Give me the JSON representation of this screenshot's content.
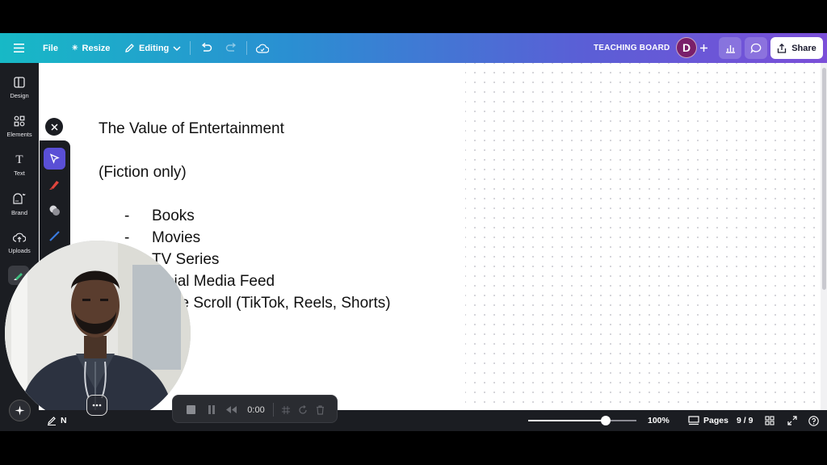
{
  "topbar": {
    "file_label": "File",
    "resize_label": "Resize",
    "editing_label": "Editing",
    "board_name": "TEACHING BOARD",
    "avatar_initial": "D",
    "share_label": "Share"
  },
  "sidebar": {
    "items": [
      {
        "label": "Design",
        "icon": "design-icon"
      },
      {
        "label": "Elements",
        "icon": "elements-icon"
      },
      {
        "label": "Text",
        "icon": "text-icon"
      },
      {
        "label": "Brand",
        "icon": "brand-icon"
      },
      {
        "label": "Uploads",
        "icon": "uploads-icon"
      }
    ]
  },
  "document": {
    "title": "The Value of Entertainment",
    "subtitle": "(Fiction only)",
    "bullets": [
      {
        "dash": "-",
        "text": "Books"
      },
      {
        "dash": "-",
        "text": "Movies"
      },
      {
        "dash": "",
        "text": "TV Series"
      },
      {
        "dash": "",
        "text": "cial Media Feed"
      },
      {
        "dash": "",
        "text": "ite Scroll (TikTok, Reels, Shorts)"
      }
    ]
  },
  "recorder": {
    "time": "0:00"
  },
  "bottombar": {
    "zoom": "100%",
    "zoom_fraction": 0.72,
    "pages_label": "Pages",
    "page_count": "9 / 9",
    "notes_label": "N"
  },
  "colors": {
    "topbar_start": "#17b9c6",
    "topbar_end": "#7b4fd8",
    "sidebar_bg": "#1b1d22",
    "avatar_bg": "#7a1f6a",
    "select_tool_bg": "#5a4fd6"
  }
}
